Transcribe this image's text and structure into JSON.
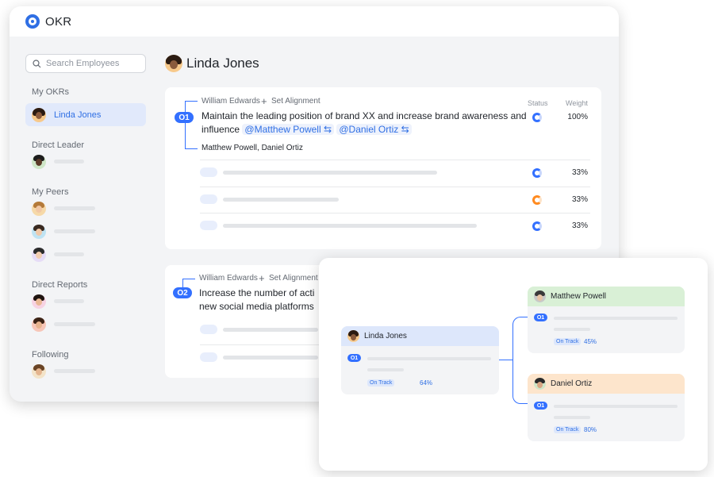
{
  "app": {
    "title": "OKR",
    "logo_icon": "okr-logo-icon",
    "accent": "#3370ff"
  },
  "sidebar": {
    "search_placeholder": "Search Employees",
    "sections": {
      "my_okrs": "My OKRs",
      "direct_leader": "Direct Leader",
      "my_peers": "My Peers",
      "direct_reports": "Direct Reports",
      "following": "Following"
    },
    "active_user": "Linda Jones"
  },
  "main": {
    "user_name": "Linda Jones",
    "columns": {
      "status": "Status",
      "weight": "Weight"
    },
    "objectives": [
      {
        "badge": "O1",
        "aligned_to": "William Edwards",
        "set_alignment": "Set Alignment",
        "text": "Maintain the leading position of brand XX and increase brand awareness and influence",
        "mentions": [
          "Matthew Powell",
          "Daniel Ortiz"
        ],
        "aligned_from": "Matthew Powell, Daniel Ortiz",
        "weight": "100%",
        "key_results": [
          {
            "weight": "33%",
            "status_color": "#3370ff"
          },
          {
            "weight": "33%",
            "status_color": "#ff8a1f"
          },
          {
            "weight": "33%",
            "status_color": "#3370ff"
          }
        ]
      },
      {
        "badge": "O2",
        "aligned_to": "William Edwards",
        "set_alignment": "Set Alignment",
        "text_line1": "Increase the number of acti",
        "text_line2": "new social media platforms"
      }
    ]
  },
  "tree": {
    "root": {
      "name": "Linda Jones",
      "badge": "O1",
      "status": "On Track",
      "progress": "64%"
    },
    "children": [
      {
        "name": "Matthew Powell",
        "badge": "O1",
        "status": "On Track",
        "progress": "45%",
        "header_color": "#d9f0d6"
      },
      {
        "name": "Daniel Ortiz",
        "badge": "O1",
        "status": "On Track",
        "progress": "80%",
        "header_color": "#fde5cc"
      }
    ]
  }
}
